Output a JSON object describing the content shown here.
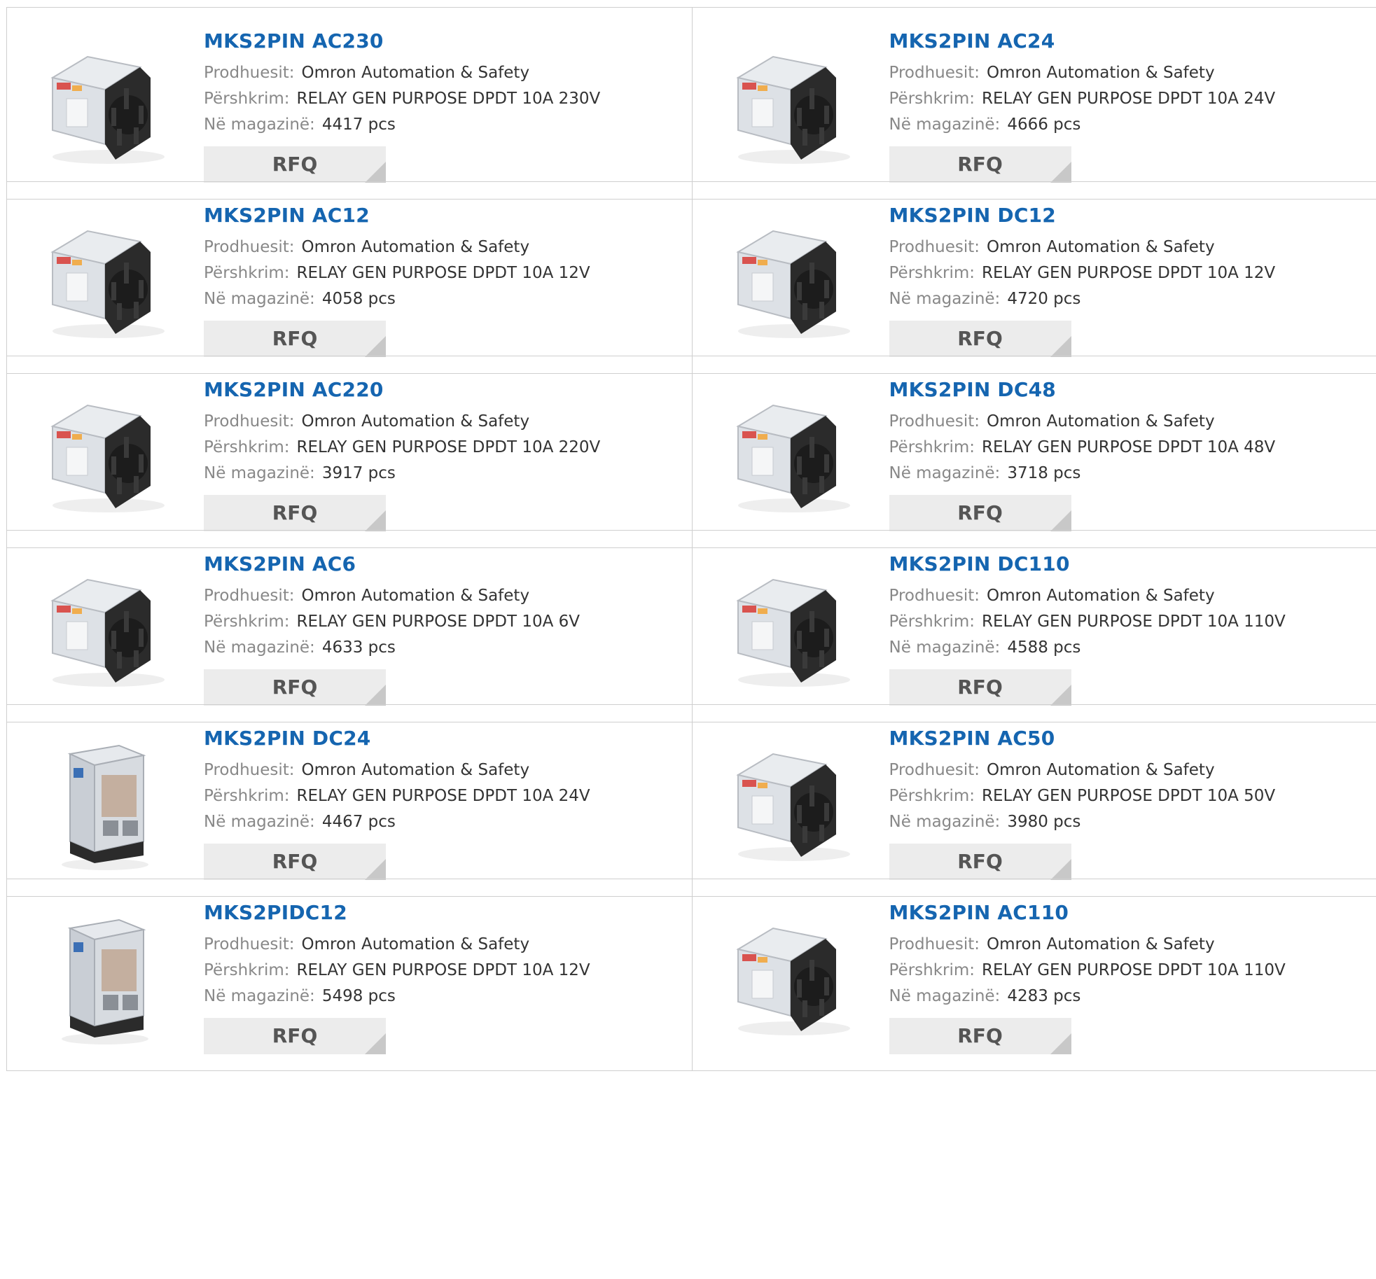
{
  "labels": {
    "manufacturer": "Prodhuesit:",
    "description": "Përshkrim:",
    "stock": "Në magazinë:",
    "rfq": "RFQ"
  },
  "colors": {
    "title": "#1565b0",
    "label": "#888888",
    "value": "#333333",
    "button_bg": "#ececec"
  },
  "products": [
    {
      "name": "MKS2PIN AC230",
      "manufacturer": "Omron Automation & Safety",
      "description": "RELAY GEN PURPOSE DPDT 10A 230V",
      "stock": "4417 pcs",
      "image": "relay-icon"
    },
    {
      "name": "MKS2PIN AC24",
      "manufacturer": "Omron Automation & Safety",
      "description": "RELAY GEN PURPOSE DPDT 10A 24V",
      "stock": "4666 pcs",
      "image": "relay-icon"
    },
    {
      "name": "MKS2PIN AC12",
      "manufacturer": "Omron Automation & Safety",
      "description": "RELAY GEN PURPOSE DPDT 10A 12V",
      "stock": "4058 pcs",
      "image": "relay-icon"
    },
    {
      "name": "MKS2PIN DC12",
      "manufacturer": "Omron Automation & Safety",
      "description": "RELAY GEN PURPOSE DPDT 10A 12V",
      "stock": "4720 pcs",
      "image": "relay-icon"
    },
    {
      "name": "MKS2PIN AC220",
      "manufacturer": "Omron Automation & Safety",
      "description": "RELAY GEN PURPOSE DPDT 10A 220V",
      "stock": "3917 pcs",
      "image": "relay-icon"
    },
    {
      "name": "MKS2PIN DC48",
      "manufacturer": "Omron Automation & Safety",
      "description": "RELAY GEN PURPOSE DPDT 10A 48V",
      "stock": "3718 pcs",
      "image": "relay-icon"
    },
    {
      "name": "MKS2PIN AC6",
      "manufacturer": "Omron Automation & Safety",
      "description": "RELAY GEN PURPOSE DPDT 10A 6V",
      "stock": "4633 pcs",
      "image": "relay-icon"
    },
    {
      "name": "MKS2PIN DC110",
      "manufacturer": "Omron Automation & Safety",
      "description": "RELAY GEN PURPOSE DPDT 10A 110V",
      "stock": "4588 pcs",
      "image": "relay-icon"
    },
    {
      "name": "MKS2PIN DC24",
      "manufacturer": "Omron Automation & Safety",
      "description": "RELAY GEN PURPOSE DPDT 10A 24V",
      "stock": "4467 pcs",
      "image": "tall-relay-icon"
    },
    {
      "name": "MKS2PIN AC50",
      "manufacturer": "Omron Automation & Safety",
      "description": "RELAY GEN PURPOSE DPDT 10A 50V",
      "stock": "3980 pcs",
      "image": "relay-icon"
    },
    {
      "name": "MKS2PIDC12",
      "manufacturer": "Omron Automation & Safety",
      "description": "RELAY GEN PURPOSE DPDT 10A 12V",
      "stock": "5498 pcs",
      "image": "tall-relay-icon"
    },
    {
      "name": "MKS2PIN AC110",
      "manufacturer": "Omron Automation & Safety",
      "description": "RELAY GEN PURPOSE DPDT 10A 110V",
      "stock": "4283 pcs",
      "image": "relay-icon"
    }
  ]
}
